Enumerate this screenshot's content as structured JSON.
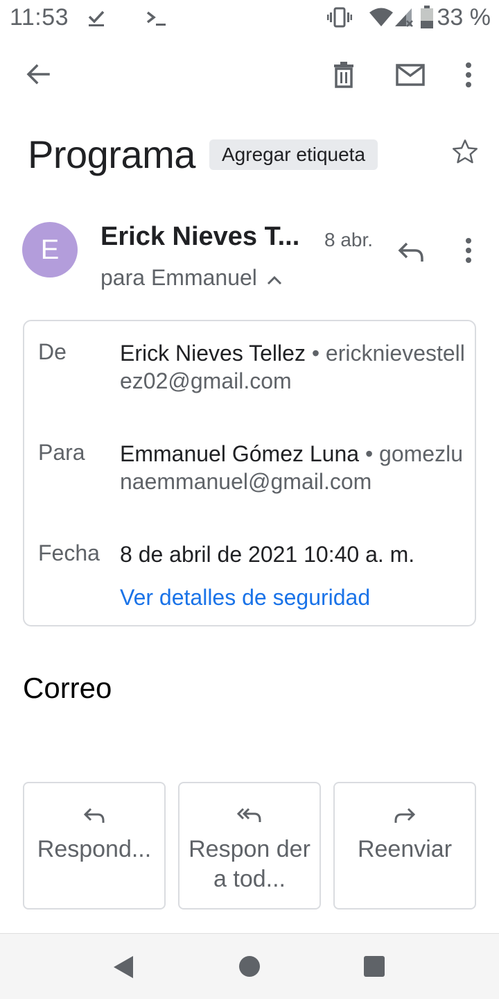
{
  "status_bar": {
    "time": "11:53",
    "battery": "33 %",
    "icons": [
      "download-done-icon",
      "terminal-icon",
      "vibrate-icon",
      "wifi-icon",
      "signal-icon",
      "battery-icon"
    ]
  },
  "toolbar": {
    "icons": [
      "back-arrow-icon",
      "delete-icon",
      "mark-unread-icon",
      "more-vert-icon"
    ]
  },
  "email": {
    "subject": "Programa",
    "label_chip": "Agregar etiqueta",
    "sender": {
      "initial": "E",
      "name": "Erick Nieves T...",
      "date": "8 abr.",
      "recipient_line": "para Emmanuel"
    },
    "details": {
      "from_label": "De",
      "from_name": "Erick Nieves Tellez",
      "from_email": "ericknievestellez02@gmail.com",
      "to_label": "Para",
      "to_name": "Emmanuel Gómez Luna",
      "to_email": "gomezlunaemmanuel@gmail.com",
      "date_label": "Fecha",
      "date_value": "8 de abril de 2021 10:40 a. m.",
      "security_link": "Ver detalles de seguridad"
    },
    "body": "Correo"
  },
  "actions": {
    "reply": "Respond...",
    "reply_all": "Respon der a tod...",
    "forward": "Reenviar"
  },
  "colors": {
    "avatar": "#b39ddb",
    "link": "#1a73e8",
    "chip": "#e8eaed",
    "border": "#dadce0"
  }
}
